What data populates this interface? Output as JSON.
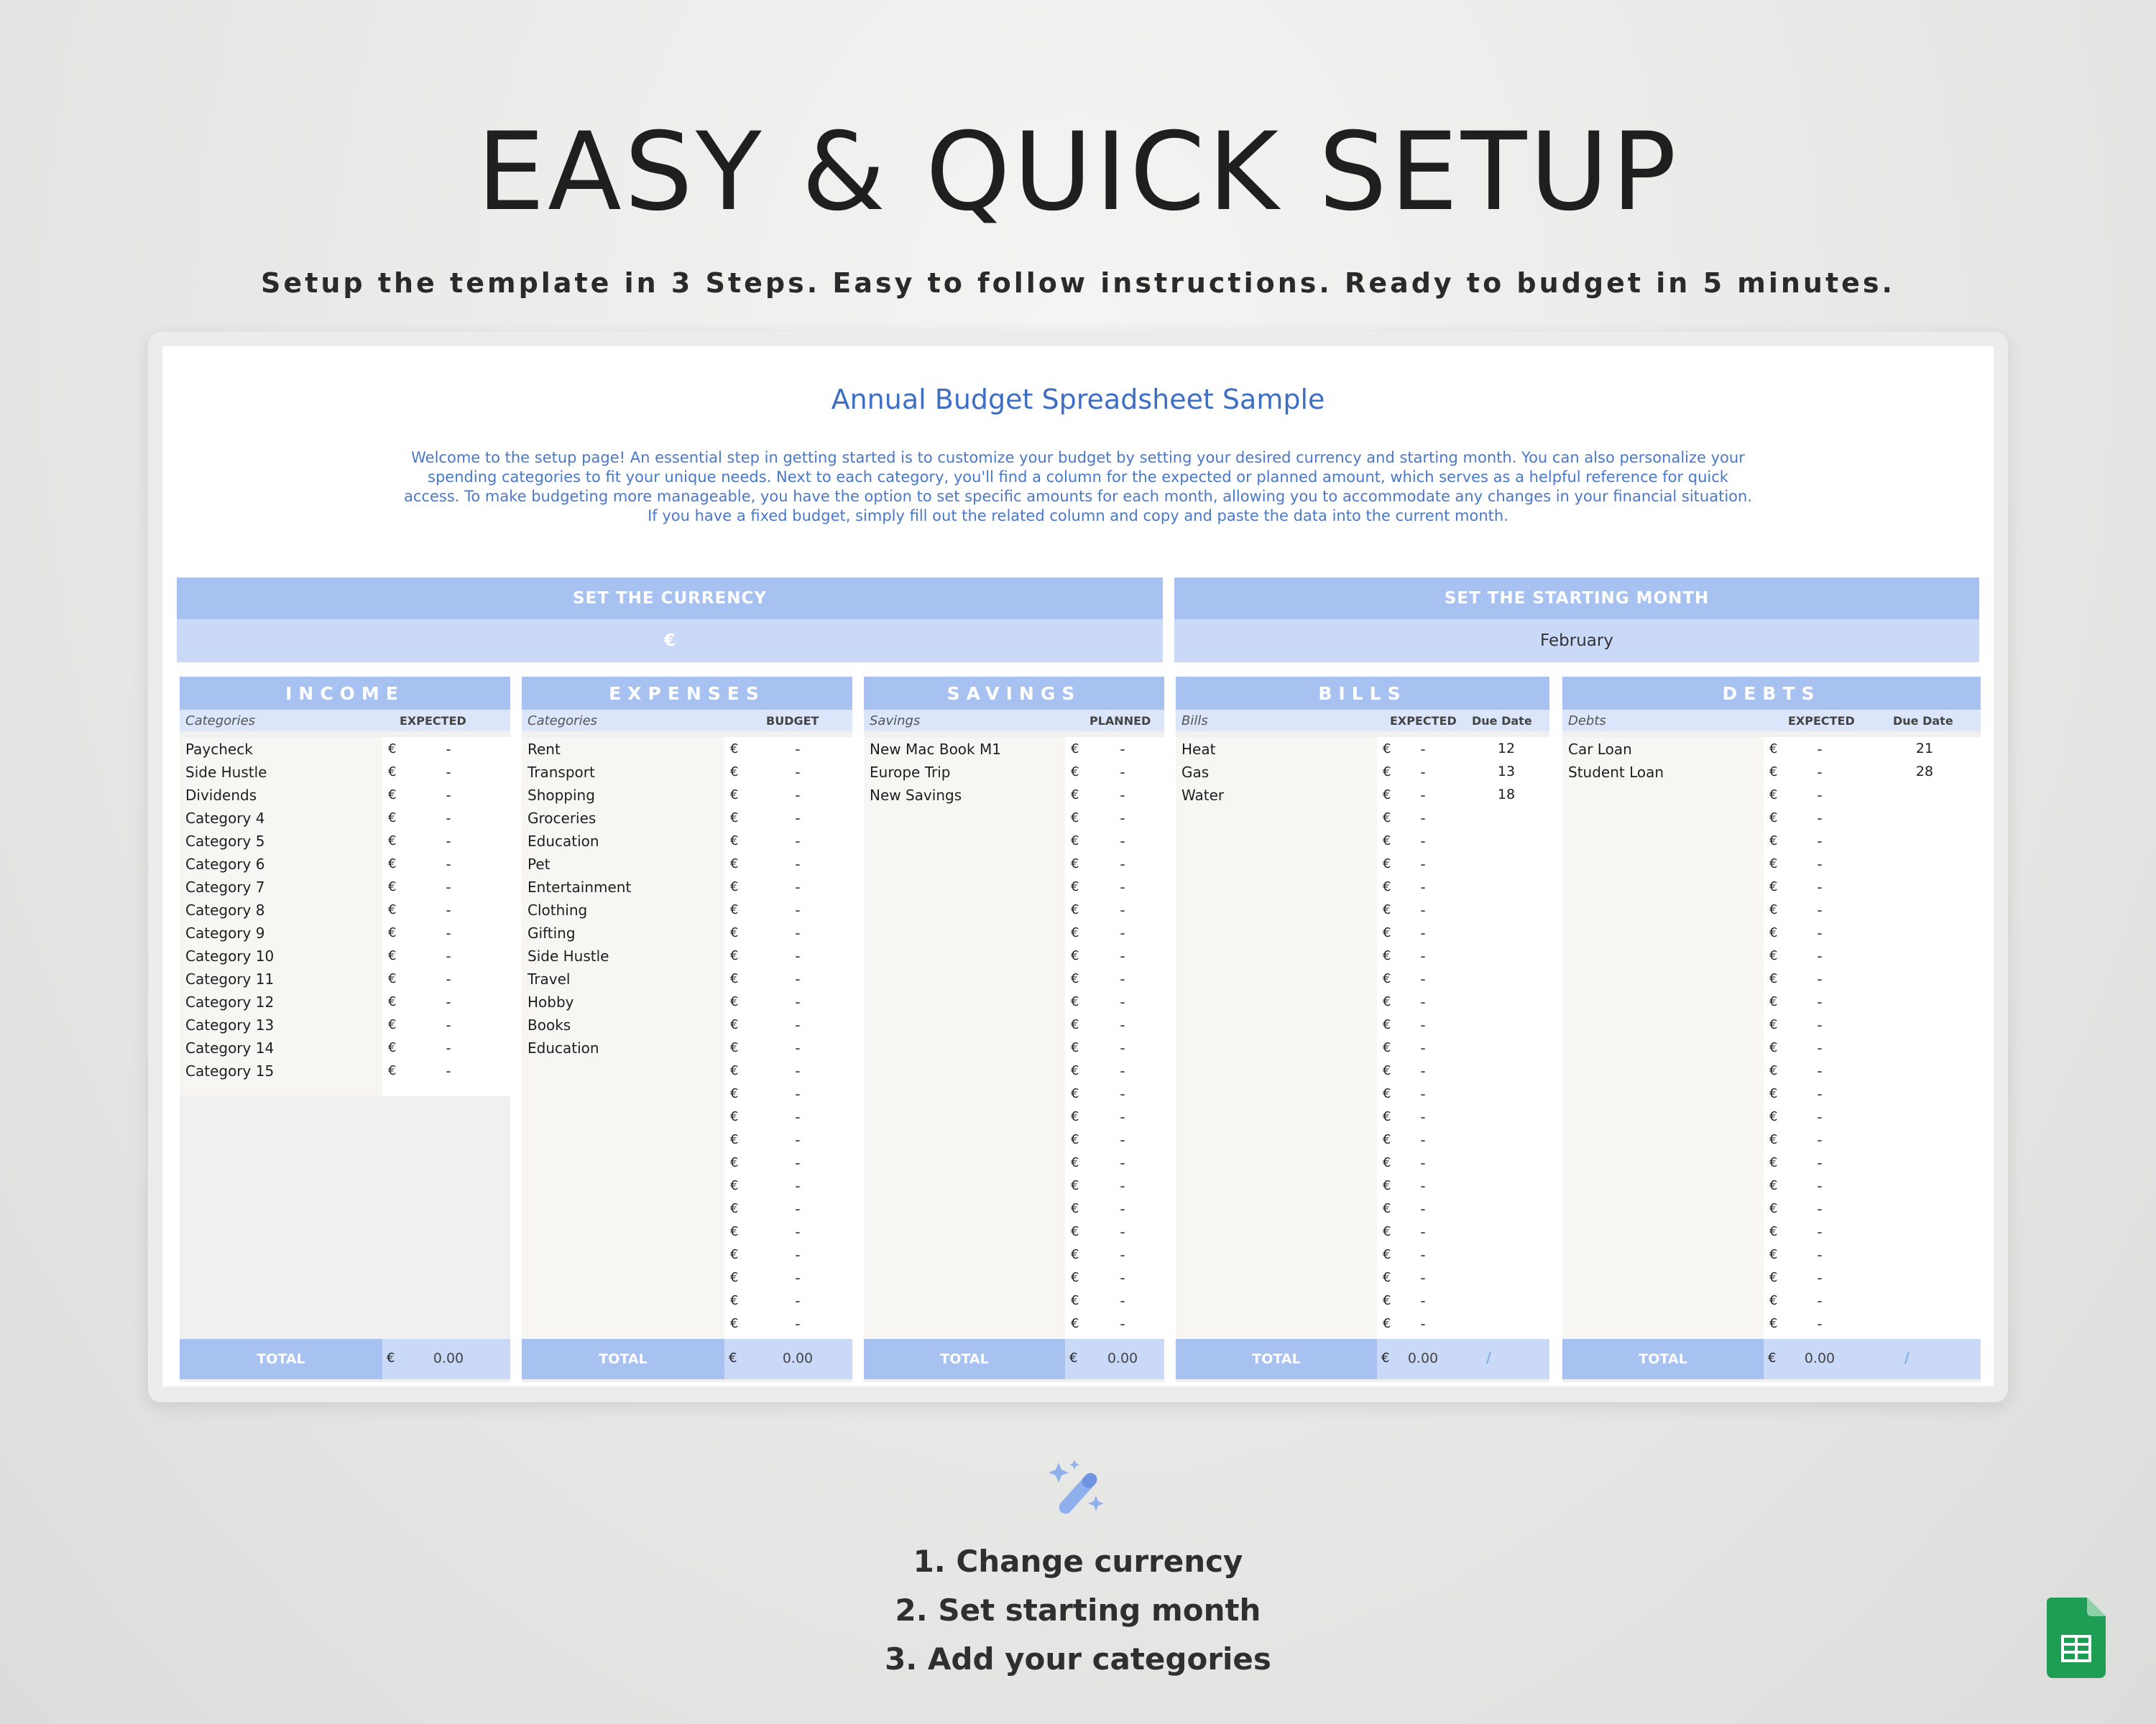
{
  "headline": "EASY & QUICK SETUP",
  "subline": "Setup the template in 3 Steps. Easy to follow instructions. Ready to budget in 5 minutes.",
  "sheet": {
    "title": "Annual Budget Spreadsheet Sample",
    "intro": "Welcome to the setup page! An essential step in getting started is to customize your budget by setting your desired currency and starting month. You can also personalize your spending categories to fit your unique needs. Next to each category, you'll find a column for the expected or planned amount, which serves as a helpful reference for quick access. To make budgeting more manageable, you have the option to set specific amounts for each month, allowing you to accommodate any changes in your financial situation. If you have a fixed budget, simply fill out the related column and copy and paste the data into the current month.",
    "currency_header": "SET THE CURRENCY",
    "currency_value": "€",
    "month_header": "SET THE STARTING MONTH",
    "month_value": "February"
  },
  "tables": {
    "income": {
      "title": "INCOME",
      "col1": "Categories",
      "col2": "EXPECTED",
      "items": [
        "Paycheck",
        "Side Hustle",
        "Dividends",
        "Category 4",
        "Category 5",
        "Category 6",
        "Category 7",
        "Category 8",
        "Category 9",
        "Category 10",
        "Category 11",
        "Category 12",
        "Category 13",
        "Category 14",
        "Category 15"
      ],
      "total_label": "TOTAL",
      "total_value": "0.00"
    },
    "expenses": {
      "title": "EXPENSES",
      "col1": "Categories",
      "col2": "BUDGET",
      "items": [
        "Rent",
        "Transport",
        "Shopping",
        "Groceries",
        "Education",
        "Pet",
        "Entertainment",
        "Clothing",
        "Gifting",
        "Side Hustle",
        "Travel",
        "Hobby",
        "Books",
        "Education"
      ],
      "total_label": "TOTAL",
      "total_value": "0.00"
    },
    "savings": {
      "title": "SAVINGS",
      "col1": "Savings",
      "col2": "PLANNED",
      "items": [
        "New Mac Book M1",
        "Europe Trip",
        "New Savings"
      ],
      "total_label": "TOTAL",
      "total_value": "0.00"
    },
    "bills": {
      "title": "BILLS",
      "col1": "Bills",
      "col2": "EXPECTED",
      "col3": "Due Date",
      "items": [
        "Heat",
        "Gas",
        "Water"
      ],
      "due": [
        "12",
        "13",
        "18"
      ],
      "total_label": "TOTAL",
      "total_value": "0.00",
      "total_extra": "/"
    },
    "debts": {
      "title": "DEBTS",
      "col1": "Debts",
      "col2": "EXPECTED",
      "col3": "Due Date",
      "items": [
        "Car Loan",
        "Student Loan"
      ],
      "due": [
        "21",
        "28"
      ],
      "total_label": "TOTAL",
      "total_value": "0.00",
      "total_extra": "/"
    }
  },
  "cell_currency": "€",
  "cell_empty": "-",
  "steps": [
    "1. Change currency",
    "2. Set starting month",
    "3. Add your categories"
  ],
  "colors": {
    "header_blue": "#a7c1f1",
    "light_blue": "#c9d9f7",
    "title_blue": "#3f6fc4",
    "sheets_green": "#1e9e55"
  },
  "icons": {
    "wand": "magic-wand-icon",
    "app": "google-sheets-icon"
  }
}
